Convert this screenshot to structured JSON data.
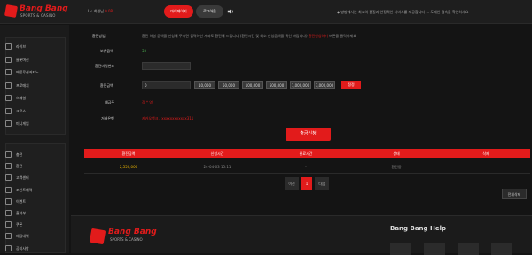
{
  "brand": {
    "name": "Bang Bang",
    "tagline": "SPORTS & CASINO"
  },
  "header": {
    "user_prefix": "Lv.",
    "user_mid": "회원님",
    "user_red1": "0",
    "user_red2": "0P",
    "mypage_label": "마이페이지",
    "logout_label": "로그아웃",
    "notice": "◆ 방방에서는 최고의 품질과 안정적인 서비스를 제공합니다 ... 도메인 접속을 확인하세요"
  },
  "sidebar": {
    "group1": [
      {
        "label": "라이브",
        "icon": "tv-icon"
      },
      {
        "label": "슬롯머신",
        "icon": "slot-icon"
      },
      {
        "label": "에볼루션카지노",
        "icon": "cards-icon"
      },
      {
        "label": "프로매치",
        "icon": "phone-icon"
      },
      {
        "label": "스페셜",
        "icon": "star-icon"
      },
      {
        "label": "크로스",
        "icon": "cross-icon"
      },
      {
        "label": "미니게임",
        "icon": "gamepad-icon"
      }
    ],
    "group2": [
      {
        "label": "충전",
        "icon": "coin-icon"
      },
      {
        "label": "환전",
        "icon": "wallet-icon"
      },
      {
        "label": "고객센터",
        "icon": "headset-icon"
      },
      {
        "label": "포인트내역",
        "icon": "point-icon"
      },
      {
        "label": "이벤트",
        "icon": "gift-icon"
      },
      {
        "label": "출석부",
        "icon": "calendar-icon"
      },
      {
        "label": "쿠폰",
        "icon": "coupon-icon"
      },
      {
        "label": "베팅내역",
        "icon": "list-icon"
      },
      {
        "label": "공지사항",
        "icon": "bell-icon"
      }
    ]
  },
  "form": {
    "notice_label": "환전방법",
    "notice_text": "환전 하실 금액을 신청해 주시면 입력하신 계좌로 환전해 드립니다 (환전시간 및 최소 신청금액을 확인 바랍니다)",
    "notice_red": "환전신청하기",
    "notice_tail": "버튼을 클릭하세요",
    "balance_label": "보유금액",
    "balance_value": "53",
    "password_label": "환전비밀번호",
    "amount_label": "환전금액",
    "amount_value": "0",
    "amount_buttons": [
      "10,000",
      "50,000",
      "100,000",
      "500,000",
      "1,000,000",
      "3,000,000"
    ],
    "reset_label": "정정",
    "depositor_label": "예금주",
    "depositor_value": "강 * 영",
    "bank_label": "거래은행",
    "bank_value": "카카오뱅크 / xxxxxxxxxxxx311",
    "submit_label": "출금신청"
  },
  "table": {
    "headers": [
      "환전금액",
      "신청시간",
      "완료시간",
      "상태",
      "삭제"
    ],
    "rows": [
      {
        "amount": "2,550,000",
        "requested": "24-04-03 15:11",
        "completed": "-",
        "status": "환전중",
        "delete": ""
      }
    ]
  },
  "pagination": {
    "prev": "이전",
    "current": "1",
    "next": "다음"
  },
  "delete_all_label": "전체삭제",
  "footer": {
    "help_title": "Bang Bang Help"
  },
  "colors": {
    "accent": "#e21b1b",
    "background": "#141414",
    "amount": "#e9b400",
    "positive": "#4caf50"
  }
}
